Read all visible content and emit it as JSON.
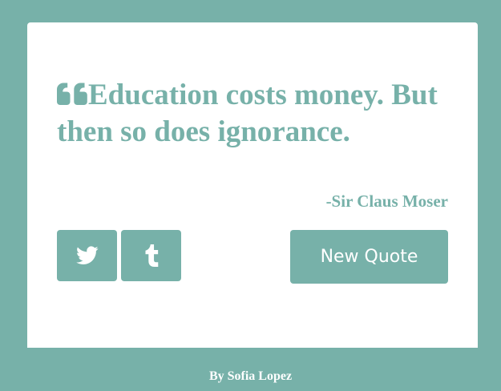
{
  "quote": {
    "text": "Education costs money. But then so does ignorance.",
    "author": "-Sir Claus Moser"
  },
  "buttons": {
    "twitter_icon": "twitter-icon",
    "tumblr_icon": "tumblr-icon",
    "new_quote_label": "New Quote"
  },
  "footer": {
    "credit": "By Sofia Lopez"
  },
  "colors": {
    "accent": "#77b1a9",
    "card_background": "#ffffff",
    "button_text": "#ffffff"
  }
}
